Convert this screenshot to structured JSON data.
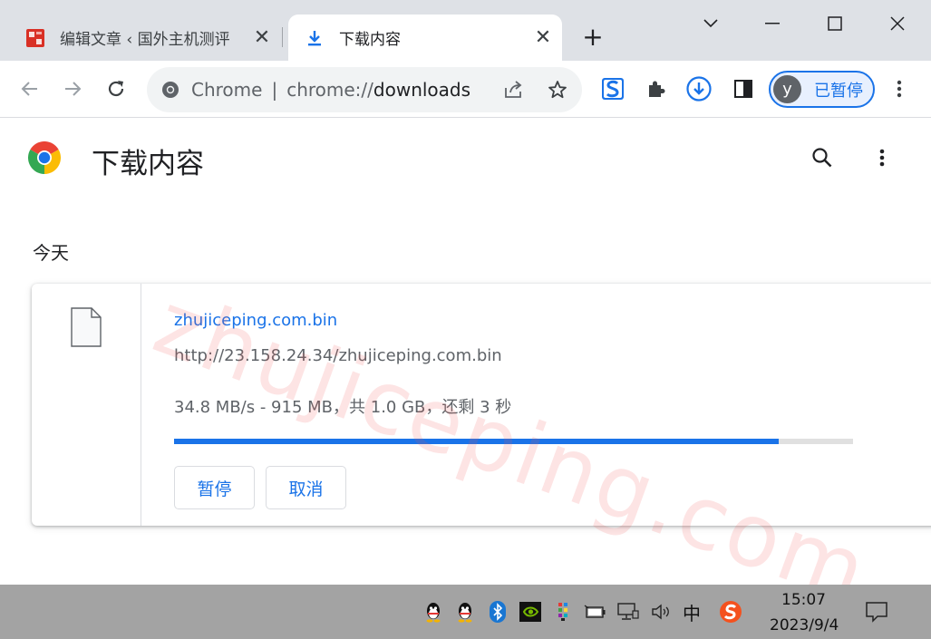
{
  "browser": {
    "tabs": [
      {
        "title": "编辑文章 ‹ 国外主机测评",
        "close": "✕"
      },
      {
        "title": "下载内容",
        "close": "✕"
      }
    ],
    "new_tab": "+",
    "window_controls": [
      "chevron-down-icon",
      "minimize-icon",
      "maximize-icon",
      "close-icon"
    ]
  },
  "toolbar": {
    "origin": "Chrome",
    "separator": "|",
    "scheme": "chrome://",
    "path": "downloads",
    "profile_initial": "y",
    "profile_status": "已暂停",
    "accent_color": "#1a73e8"
  },
  "page": {
    "title": "下载内容",
    "date_group": "今天",
    "watermark": "zhujiceping.com"
  },
  "download": {
    "file_name": "zhujiceping.com.bin",
    "url": "http://23.158.24.34/zhujiceping.com.bin",
    "status": "34.8 MB/s - 915 MB，共 1.0 GB，还剩 3 秒",
    "progress_percent": 89,
    "pause_label": "暂停",
    "cancel_label": "取消"
  },
  "taskbar": {
    "ime_label": "中",
    "time": "15:07",
    "date": "2023/9/4"
  }
}
